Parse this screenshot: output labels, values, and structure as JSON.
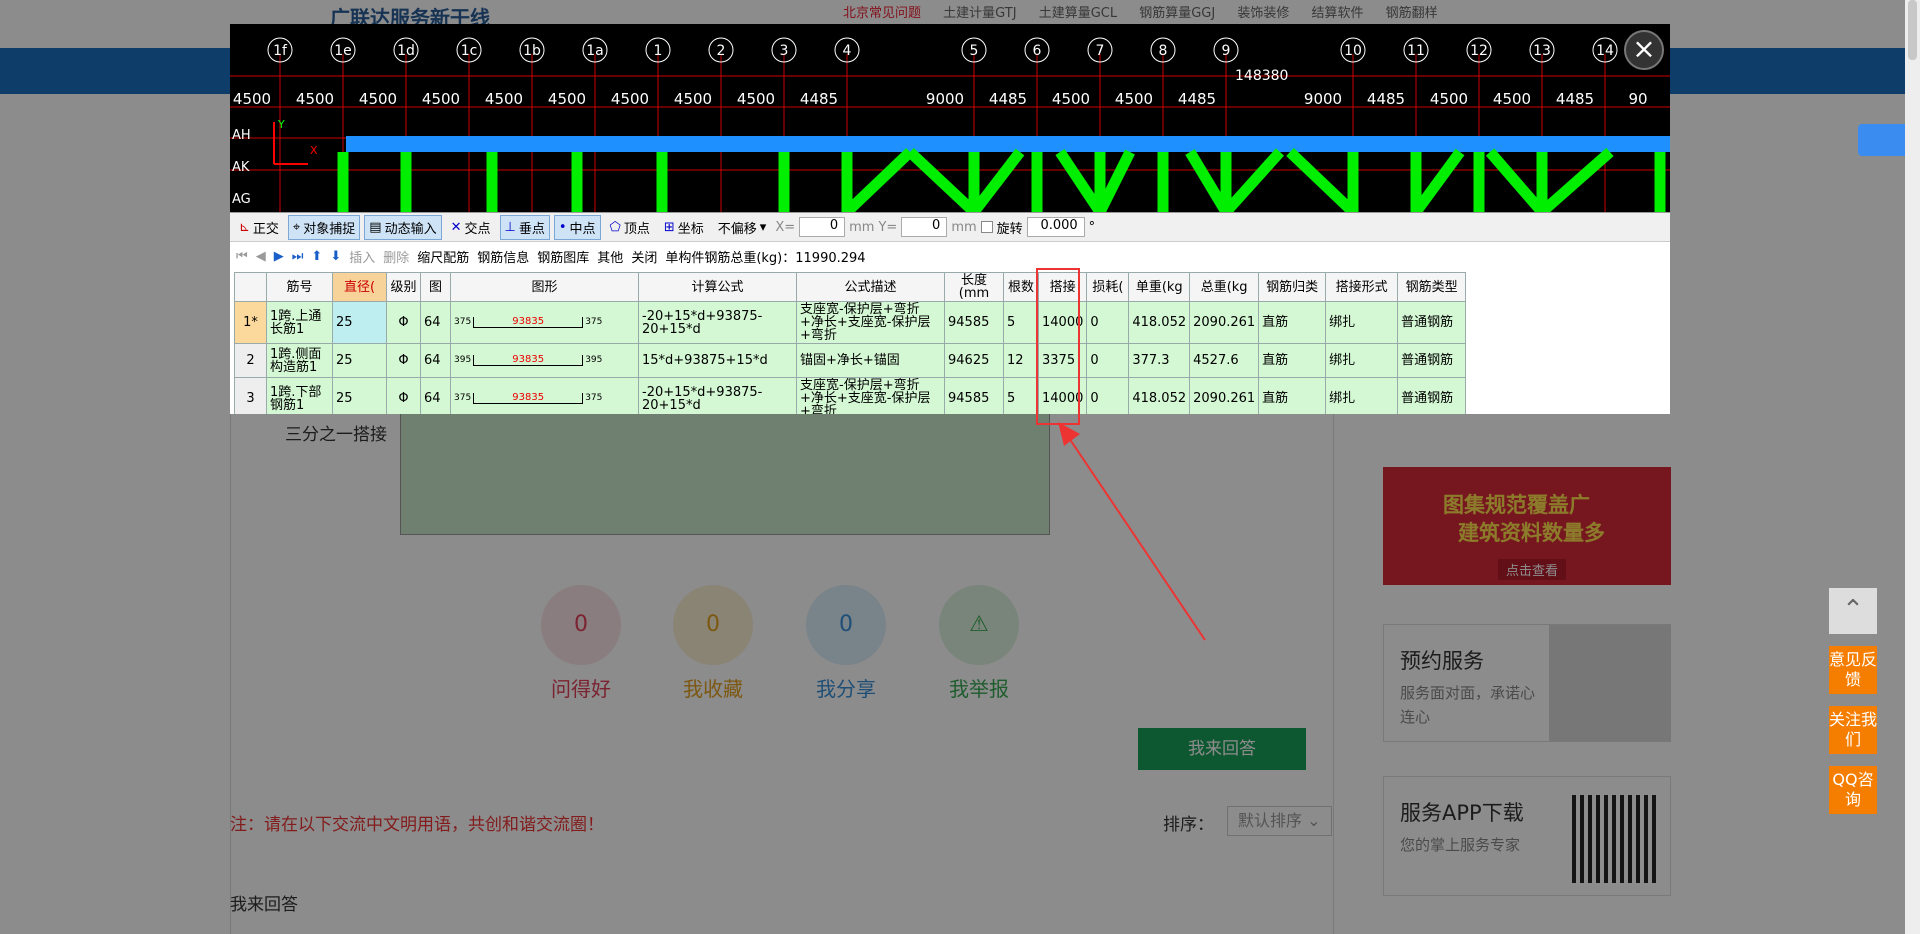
{
  "header": {
    "brand": "广联达服务新干线",
    "nav": [
      "北京常见问题",
      "土建计量GTJ",
      "土建算量GCL",
      "钢筋算量GGJ",
      "装饰装修",
      "结算软件",
      "钢筋翻样"
    ]
  },
  "cad": {
    "axes_top": [
      "1f",
      "1e",
      "1d",
      "1c",
      "1b",
      "1a",
      "1",
      "2",
      "3",
      "4",
      "5",
      "6",
      "7",
      "8",
      "9",
      "10",
      "11",
      "12",
      "13",
      "14"
    ],
    "total_dim": "148380",
    "dims": [
      "4500",
      "4500",
      "4500",
      "4500",
      "4500",
      "4500",
      "4500",
      "4500",
      "4500",
      "4485",
      "9000",
      "4485",
      "4500",
      "4500",
      "4485",
      "9000",
      "4485",
      "4500",
      "4500",
      "4485",
      "90"
    ],
    "axes_left": [
      "AH",
      "AK",
      "AG"
    ],
    "coord_y": "Y",
    "coord_x": "X"
  },
  "toolbar1": {
    "ortho": "正交",
    "snap": "对象捕捉",
    "dyn_input": "动态输入",
    "intersect": "交点",
    "perp": "垂点",
    "mid": "中点",
    "vertex": "顶点",
    "coord": "坐标",
    "offset_mode": "不偏移",
    "x_label": "X=",
    "x_value": "0",
    "mm1": "mm",
    "y_label": "Y=",
    "y_value": "0",
    "mm2": "mm",
    "rotate_label": "旋转",
    "rotate_value": "0.000",
    "degree": "°"
  },
  "toolbar2": {
    "insert": "插入",
    "delete": "删除",
    "scale_rebar": "缩尺配筋",
    "rebar_info": "钢筋信息",
    "rebar_lib": "钢筋图库",
    "other": "其他",
    "close": "关闭",
    "total": "单构件钢筋总重(kg)：11990.294"
  },
  "table": {
    "headers": [
      "",
      "筋号",
      "直径(",
      "级别",
      "图",
      "图形",
      "计算公式",
      "公式描述",
      "长度(mm",
      "根数",
      "搭接",
      "损耗(",
      "单重(kg",
      "总重(kg",
      "钢筋归类",
      "搭接形式",
      "钢筋类型"
    ],
    "rows": [
      {
        "no": "1*",
        "name": "1跨.上通长筋1",
        "dia": "25",
        "grade": "Φ",
        "fig": "64",
        "l": "375",
        "mid": "93835",
        "r": "375",
        "formula": "-20+15*d+93875-20+15*d",
        "desc": "支座宽-保护层+弯折+净长+支座宽-保护层+弯折",
        "len": "94585",
        "count": "5",
        "lap": "14000",
        "loss": "0",
        "unit": "418.052",
        "total": "2090.261",
        "cat": "直筋",
        "lapform": "绑扎",
        "type": "普通钢筋"
      },
      {
        "no": "2",
        "name": "1跨.侧面构造筋1",
        "dia": "25",
        "grade": "Φ",
        "fig": "64",
        "l": "395",
        "mid": "93835",
        "r": "395",
        "formula": "15*d+93875+15*d",
        "desc": "锚固+净长+锚固",
        "len": "94625",
        "count": "12",
        "lap": "3375",
        "loss": "0",
        "unit": "377.3",
        "total": "4527.6",
        "cat": "直筋",
        "lapform": "绑扎",
        "type": "普通钢筋"
      },
      {
        "no": "3",
        "name": "1跨.下部钢筋1",
        "dia": "25",
        "grade": "Φ",
        "fig": "64",
        "l": "375",
        "mid": "93835",
        "r": "375",
        "formula": "-20+15*d+93875-20+15*d",
        "desc": "支座宽-保护层+弯折+净长+支座宽-保护层+弯折",
        "len": "94585",
        "count": "5",
        "lap": "14000",
        "loss": "0",
        "unit": "418.052",
        "total": "2090.261",
        "cat": "直筋",
        "lapform": "绑扎",
        "type": "普通钢筋"
      }
    ]
  },
  "question": {
    "snippet": "三分之一搭接"
  },
  "stats": [
    {
      "count": "0",
      "label": "问得好",
      "color": "#e0405a"
    },
    {
      "count": "0",
      "label": "我收藏",
      "color": "#e3a020"
    },
    {
      "count": "0",
      "label": "我分享",
      "color": "#3a8fd8"
    },
    {
      "count": "0",
      "label": "我举报",
      "color": "#3aaa55"
    }
  ],
  "answer_button": "我来回答",
  "notice": "注：请在以下交流中文明用语，共创和谐交流圈！",
  "sort": {
    "label": "排序：",
    "value": "默认排序"
  },
  "my_answer": "我来回答",
  "sidebar": {
    "banner1_line1": "图集规范覆盖广",
    "banner1_line2": "建筑资料数量多",
    "banner1_btn": "点击查看",
    "appoint_title": "预约服务",
    "appoint_desc": "服务面对面，承诺心连心",
    "app_title": "服务APP下载",
    "app_desc": "您的掌上服务专家"
  },
  "float": {
    "feedback": "意见反馈",
    "follow": "关注我们",
    "qq": "QQ咨询"
  }
}
